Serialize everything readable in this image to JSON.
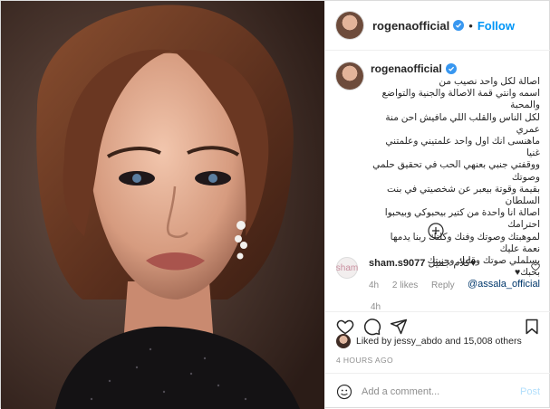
{
  "header": {
    "username": "rogenaofficial",
    "follow_label": "Follow",
    "separator": "•"
  },
  "caption": {
    "username": "rogenaofficial",
    "text": "اصالة لكل واحد نصيب من\nاسمه وانتي قمة الاصالة والجنية والتواضع والمحبة\nلكل الناس والقلب اللي مافيش احن منة عمري\nماهنسى انك اول واحد علمتيني وعلمتني غنيا\nووقفتي جنبي بعنهي الحب في تحقيق حلمي وصوتك\nبقيمة وقوتة بيعبر عن شخصيتي في بنت السلطان\nاصالة انا واحدة من كتير بيحبوكي وبيحبوا احترامك\nلموهبتك وصوتك وفنك وكلتك ربنا يدمها نعمة عليك\nيسلملي صوتك وقلبك وحنيتك\nبحبك♥",
    "mention": "@assala_official",
    "age": "4h"
  },
  "reply": {
    "avatar_text": "sham",
    "username": "sham.s9077",
    "text": "كلام جميل♥",
    "age": "4h",
    "likes": "2 likes",
    "reply_label": "Reply"
  },
  "likes": {
    "text": "Liked by jessy_abdo and 15,008 others"
  },
  "timestamp": "4 HOURS AGO",
  "comment_box": {
    "placeholder": "Add a comment...",
    "post_label": "Post"
  },
  "colors": {
    "accent": "#0095f6",
    "post_disabled": "#b2dffc",
    "muted": "#8e8e8e"
  },
  "icons": [
    "verified-icon",
    "more-icon",
    "heart-icon",
    "comment-icon",
    "share-icon",
    "bookmark-icon",
    "emoji-icon"
  ]
}
